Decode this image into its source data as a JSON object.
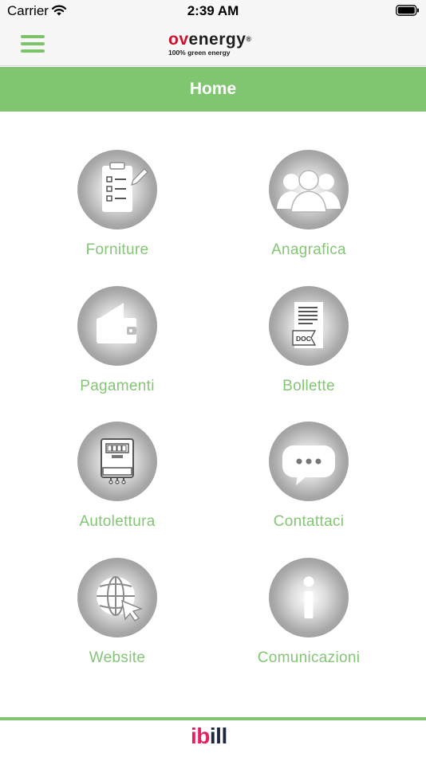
{
  "status_bar": {
    "carrier": "Carrier",
    "time": "2:39 AM"
  },
  "nav": {
    "logo_ov": "ov",
    "logo_energy": "energy",
    "logo_reg": "®",
    "logo_tagline": "100% green energy"
  },
  "page_title": "Home",
  "tiles": [
    {
      "label": "Forniture",
      "icon": "clipboard-checklist-icon"
    },
    {
      "label": "Anagrafica",
      "icon": "people-group-icon"
    },
    {
      "label": "Pagamenti",
      "icon": "wallet-icon"
    },
    {
      "label": "Bollette",
      "icon": "document-icon"
    },
    {
      "label": "Autolettura",
      "icon": "meter-icon"
    },
    {
      "label": "Contattaci",
      "icon": "chat-bubble-icon"
    },
    {
      "label": "Website",
      "icon": "globe-cursor-icon"
    },
    {
      "label": "Comunicazioni",
      "icon": "info-icon"
    }
  ],
  "doc_badge": "DOC",
  "footer": {
    "brand_i": "i",
    "brand_b": "b",
    "brand_rest": "ill"
  },
  "colors": {
    "accent_green": "#80c671",
    "label_green": "#84c576",
    "logo_red": "#d0112b",
    "ibill_pink": "#e5205f",
    "ibill_navy": "#1e2640"
  }
}
